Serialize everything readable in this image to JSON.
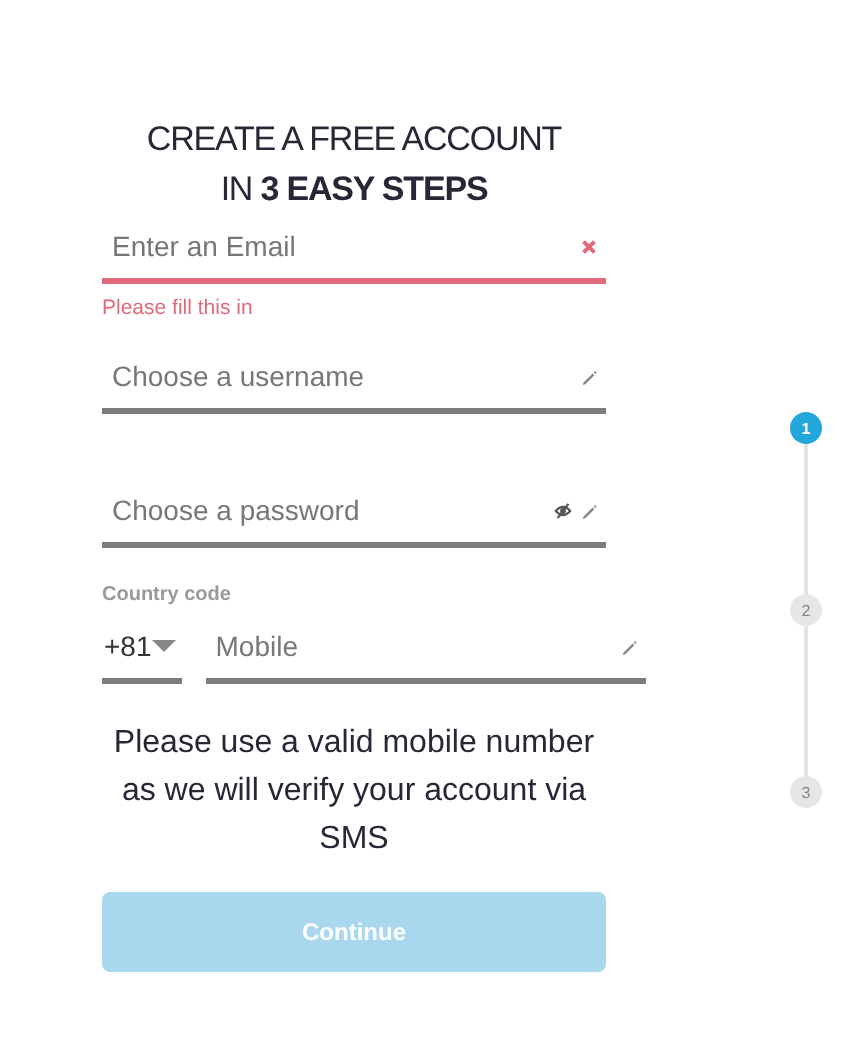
{
  "heading": {
    "line_1": "CREATE A FREE ACCOUNT",
    "line_2": "IN **3 EASY STEPS**"
  },
  "fields": [
    {
      "kind": "email",
      "placeholder": "Enter an Email",
      "invalid": true,
      "error": "Please fill this in"
    },
    {
      "kind": "username",
      "placeholder": "Choose a username",
      "invalid": false
    },
    {
      "kind": "password",
      "placeholder": "Choose a password",
      "invalid": false
    }
  ],
  "phone": {
    "country_label": "Country code",
    "country_value": "+81",
    "mobile_placeholder": "Mobile"
  },
  "note": "Please use a valid mobile number as we will verify your account via SMS",
  "button": {
    "label": "Continue",
    "disabled": true
  },
  "steps": [
    {
      "label": "1",
      "selected": true
    },
    {
      "label": "2",
      "selected": false
    },
    {
      "label": "3",
      "selected": false
    }
  ]
}
